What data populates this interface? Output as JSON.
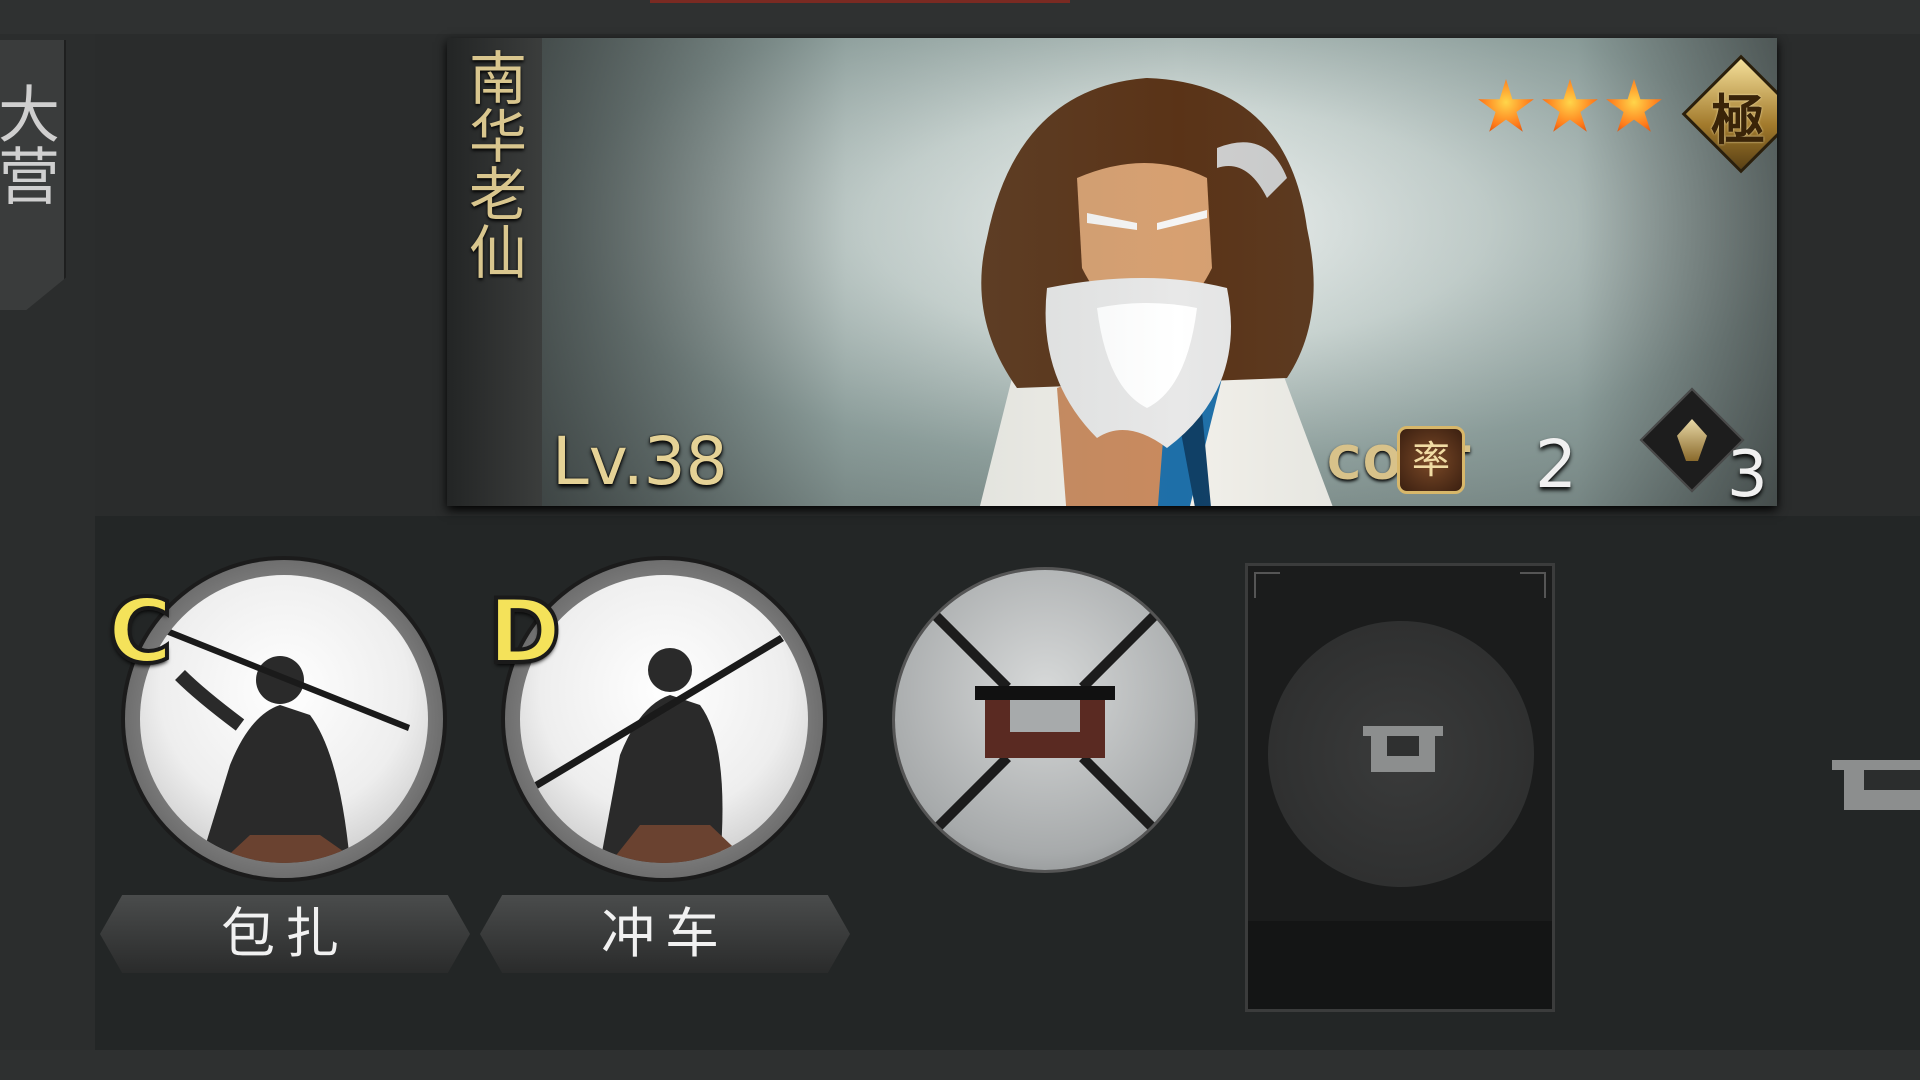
{
  "side_tab": {
    "label": "大营"
  },
  "hero": {
    "name": "南华老仙",
    "level_text": "Lv.38",
    "stars": 3,
    "grade_char": "極",
    "cost_label": "COST",
    "cost_badge_char": "率",
    "cost_value": "2",
    "troop_value": "3",
    "icons": [
      "star-icon",
      "grade-badge-icon",
      "cost-badge-icon",
      "troop-type-icon"
    ]
  },
  "skills": [
    {
      "grade": "C",
      "name": "包扎",
      "state": "unlocked"
    },
    {
      "grade": "D",
      "name": "冲车",
      "state": "unlocked"
    }
  ],
  "locked_skill": {
    "icon": "lock-icon",
    "state": "locked"
  },
  "empty_slot": {
    "icon": "lock-icon",
    "state": "empty"
  },
  "colors": {
    "star": "#ff7a1a",
    "gold_text": "#d9c68e",
    "grade_letter": "#f4e25a",
    "panel_bg": "#232626"
  }
}
